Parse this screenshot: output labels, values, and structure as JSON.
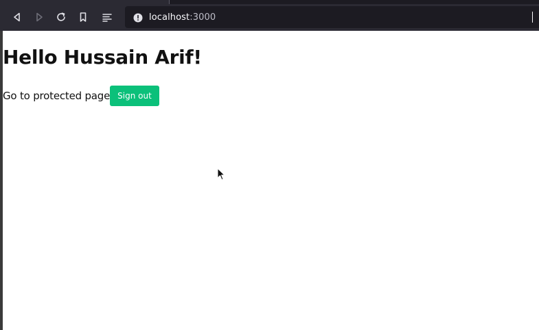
{
  "browser": {
    "url_host": "localhost",
    "url_port": ":3000",
    "icons": {
      "back": "back-arrow-icon",
      "forward": "forward-arrow-icon",
      "reload": "reload-icon",
      "bookmark": "bookmark-icon",
      "reader": "reader-view-icon",
      "site_info": "site-info-icon"
    }
  },
  "page": {
    "heading": "Hello Hussain Arif!",
    "protected_link": "Go to protected page",
    "sign_out_label": "Sign out"
  },
  "colors": {
    "accent": "#0bc07a",
    "toolbar": "#2b2a33",
    "urlbar": "#1c1b22"
  }
}
